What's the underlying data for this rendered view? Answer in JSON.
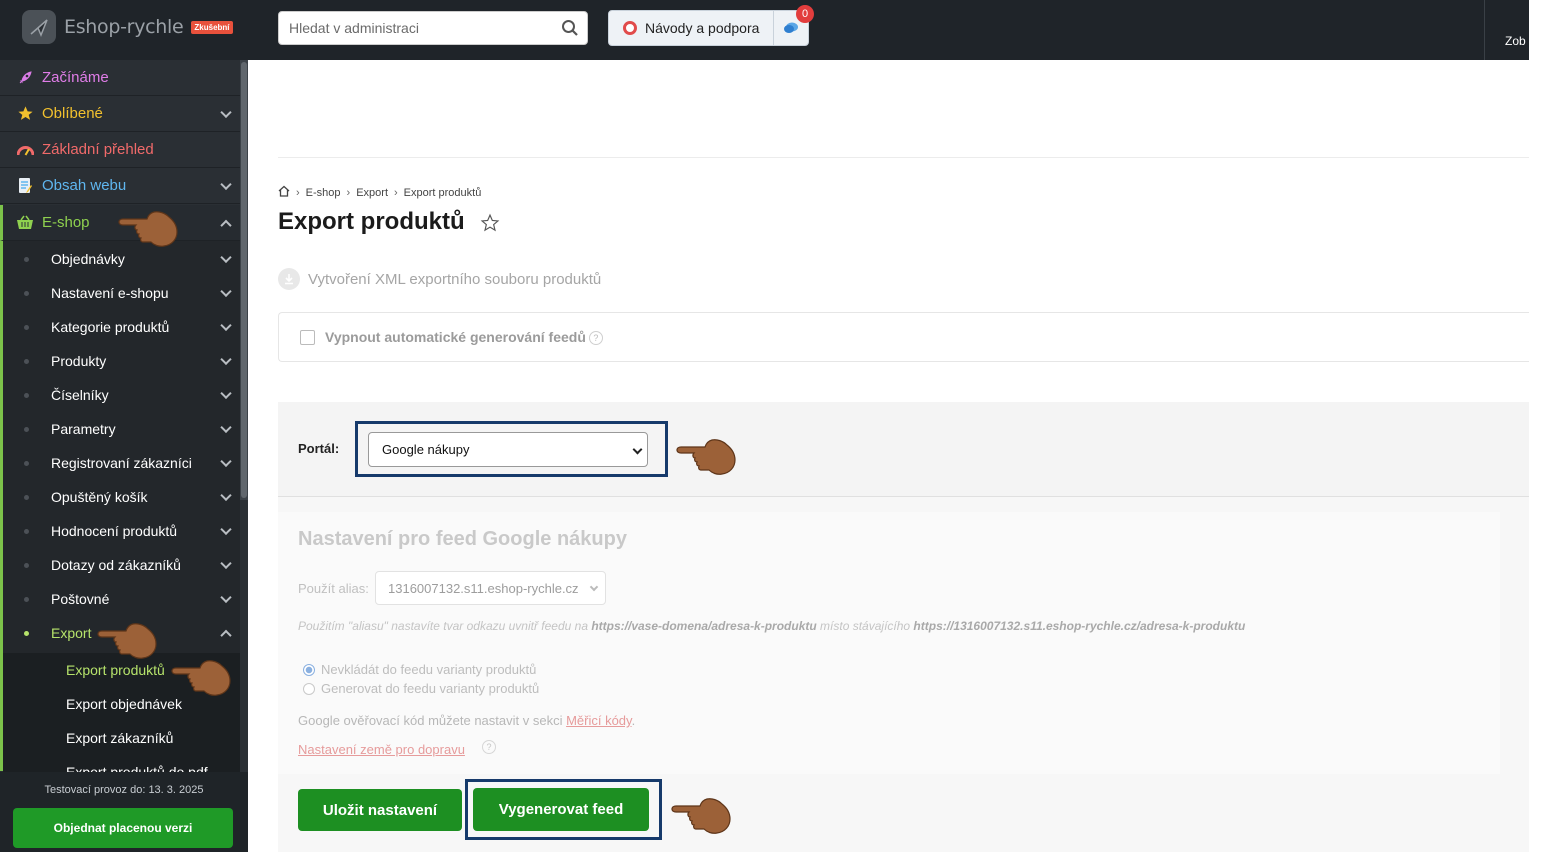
{
  "topbar": {
    "brand": "Eshop-rychle",
    "brand_badge": "Zkušební",
    "search_placeholder": "Hledat v administraci",
    "help_label": "Návody a podpora",
    "chat_badge": "0",
    "right_cut_text": "Zob"
  },
  "sidebar": {
    "items": [
      {
        "label": "Začínáme",
        "color": "#e07de8"
      },
      {
        "label": "Oblíbené",
        "color": "#f2c12e"
      },
      {
        "label": "Základní přehled",
        "color": "#f06a6a"
      },
      {
        "label": "Obsah webu",
        "color": "#5fb6ef"
      },
      {
        "label": "E-shop",
        "color": "#8fd14f"
      }
    ],
    "eshop_subitems": [
      "Objednávky",
      "Nastavení e-shopu",
      "Kategorie produktů",
      "Produkty",
      "Číselníky",
      "Parametry",
      "Registrovaní zákazníci",
      "Opuštěný košík",
      "Hodnocení produktů",
      "Dotazy od zákazníků",
      "Poštovné",
      "Export"
    ],
    "export_subitems": [
      "Export produktů",
      "Export objednávek",
      "Export zákazníků",
      "Export produktů do pdf"
    ],
    "trial_text": "Testovací provoz do: 13. 3. 2025",
    "order_button": "Objednat placenou verzi"
  },
  "main": {
    "breadcrumb": [
      "E-shop",
      "Export",
      "Export produktů"
    ],
    "title": "Export produktů",
    "subtitle": "Vytvoření XML exportního souboru produktů",
    "auto_generate_label": "Vypnout automatické generování feedů",
    "portal_label": "Portál:",
    "portal_value": "Google nákupy",
    "feed_title": "Nastavení pro feed Google nákupy",
    "alias_label": "Použít alias:",
    "alias_value": "1316007132.s11.eshop-rychle.cz",
    "alias_note_pre": "Použitím \"aliasu\" nastavíte tvar odkazu uvnitř feedu na ",
    "alias_note_url1": "https://vase-domena/adresa-k-produktu",
    "alias_note_mid": " místo stávajícího ",
    "alias_note_url2": "https://1316007132.s11.eshop-rychle.cz/adresa-k-produktu",
    "radio_no_variants": "Nevkládát do feedu varianty produktů",
    "radio_variants": "Generovat do feedu varianty produktů",
    "google_note_pre": "Google ověřovací kód můžete nastavit v sekci ",
    "google_note_link": "Měřicí kódy",
    "google_note_post": ".",
    "shipping_link": "Nastavení země pro dopravu",
    "save_button": "Uložit nastavení",
    "generate_button": "Vygenerovat feed"
  },
  "colors": {
    "accent_green": "#1d8f22",
    "highlight_border": "#163a6b",
    "active_sub": "#b6e36b"
  }
}
